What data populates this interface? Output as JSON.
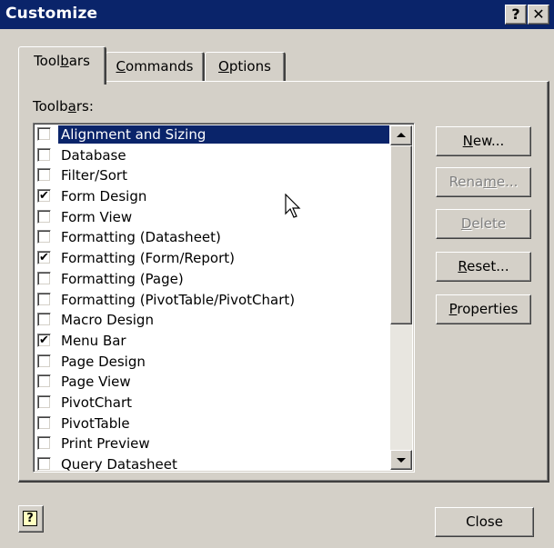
{
  "window": {
    "title": "Customize",
    "help_button": "?",
    "close_button": "✕"
  },
  "tabs": [
    {
      "label": "Toolbars",
      "mnemonic_char": "b",
      "active": true
    },
    {
      "label": "Commands",
      "mnemonic_char": "C",
      "active": false
    },
    {
      "label": "Options",
      "mnemonic_char": "O",
      "active": false
    }
  ],
  "toolbars_list": {
    "label": "Toolbars:",
    "label_mnemonic_char": "a",
    "items": [
      {
        "label": "Alignment and Sizing",
        "checked": false,
        "selected": true
      },
      {
        "label": "Database",
        "checked": false,
        "selected": false
      },
      {
        "label": "Filter/Sort",
        "checked": false,
        "selected": false
      },
      {
        "label": "Form Design",
        "checked": true,
        "selected": false
      },
      {
        "label": "Form View",
        "checked": false,
        "selected": false
      },
      {
        "label": "Formatting (Datasheet)",
        "checked": false,
        "selected": false
      },
      {
        "label": "Formatting (Form/Report)",
        "checked": true,
        "selected": false
      },
      {
        "label": "Formatting (Page)",
        "checked": false,
        "selected": false
      },
      {
        "label": "Formatting (PivotTable/PivotChart)",
        "checked": false,
        "selected": false
      },
      {
        "label": "Macro Design",
        "checked": false,
        "selected": false
      },
      {
        "label": "Menu Bar",
        "checked": true,
        "selected": false
      },
      {
        "label": "Page Design",
        "checked": false,
        "selected": false
      },
      {
        "label": "Page View",
        "checked": false,
        "selected": false
      },
      {
        "label": "PivotChart",
        "checked": false,
        "selected": false
      },
      {
        "label": "PivotTable",
        "checked": false,
        "selected": false
      },
      {
        "label": "Print Preview",
        "checked": false,
        "selected": false
      },
      {
        "label": "Query Datasheet",
        "checked": false,
        "selected": false
      }
    ],
    "checkmark": "✔"
  },
  "buttons": {
    "new": {
      "label": "New...",
      "enabled": true
    },
    "rename": {
      "label": "Rename...",
      "enabled": false
    },
    "delete": {
      "label": "Delete",
      "enabled": false
    },
    "reset": {
      "label": "Reset...",
      "enabled": true
    },
    "properties": {
      "label": "Properties",
      "enabled": true
    }
  },
  "footer": {
    "help_icon": "?",
    "close_label": "Close"
  },
  "icons": {
    "scroll_up": "scroll-up-arrow-icon",
    "scroll_down": "scroll-down-arrow-icon",
    "cursor": "mouse-pointer-icon"
  },
  "colors": {
    "title_bar": "#0a246a",
    "selection": "#0a246a",
    "face": "#d4d0c8"
  }
}
